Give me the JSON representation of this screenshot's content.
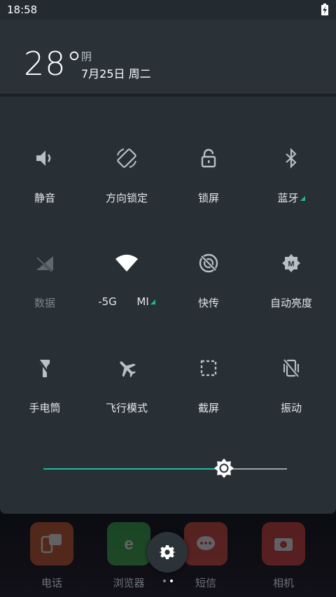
{
  "status_bar": {
    "time": "18:58"
  },
  "header": {
    "temperature": "28°",
    "weather": "阴",
    "date": "7月25日 周二"
  },
  "tiles": [
    {
      "label": "静音",
      "icon": "volume-icon"
    },
    {
      "label": "方向锁定",
      "icon": "rotation-lock-icon"
    },
    {
      "label": "锁屏",
      "icon": "lock-icon"
    },
    {
      "label": "蓝牙",
      "icon": "bluetooth-icon"
    },
    {
      "label": "数据",
      "icon": "mobile-data-off-icon"
    },
    {
      "label": "-5G      MI",
      "icon": "wifi-icon"
    },
    {
      "label": "快传",
      "icon": "quick-share-icon"
    },
    {
      "label": "自动亮度",
      "icon": "auto-brightness-icon"
    },
    {
      "label": "手电筒",
      "icon": "flashlight-icon"
    },
    {
      "label": "飞行模式",
      "icon": "airplane-icon"
    },
    {
      "label": "截屏",
      "icon": "screenshot-icon"
    },
    {
      "label": "振动",
      "icon": "vibrate-off-icon"
    }
  ],
  "brightness": {
    "level": 0.74
  },
  "dock": [
    {
      "label": "电话",
      "icon": "phone-icon"
    },
    {
      "label": "浏览器",
      "icon": "browser-icon"
    },
    {
      "label": "短信",
      "icon": "messages-icon"
    },
    {
      "label": "相机",
      "icon": "camera-icon"
    }
  ],
  "colors": {
    "accent": "#1fb8a0",
    "panel": "#283035"
  }
}
